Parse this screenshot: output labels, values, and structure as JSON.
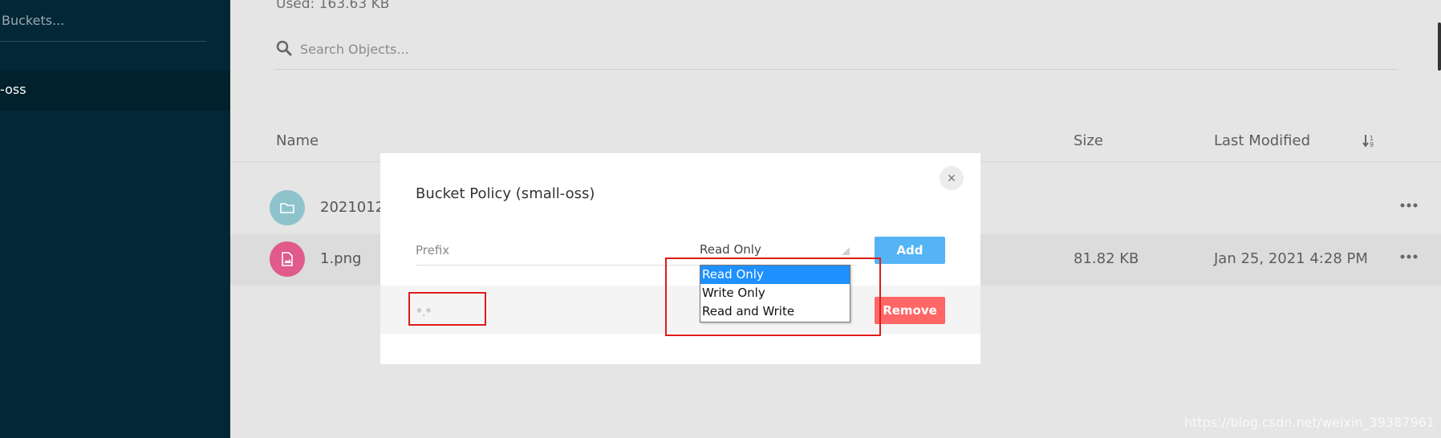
{
  "sidebar": {
    "search_text": "Buckets...",
    "active_bucket": "-oss"
  },
  "main": {
    "used_text": "Used: 163.63 KB",
    "search_placeholder": "Search Objects...",
    "columns": {
      "name": "Name",
      "size": "Size",
      "last_modified": "Last Modified"
    },
    "rows": [
      {
        "name": "2021012",
        "size": "",
        "last_modified": "",
        "type": "folder-icon",
        "icon_color": "#8fc3cc"
      },
      {
        "name": "1.png",
        "size": "81.82 KB",
        "last_modified": "Jan 25, 2021 4:28 PM",
        "type": "image-file-icon",
        "icon_color": "#e05a8a"
      }
    ]
  },
  "modal": {
    "title": "Bucket Policy (small-oss)",
    "close_symbol": "×",
    "prefix_placeholder": "Prefix",
    "select_value": "Read Only",
    "add_label": "Add",
    "remove_label": "Remove",
    "policy_prefix": "*.*",
    "dropdown_options": [
      "Read Only",
      "Write Only",
      "Read and Write"
    ],
    "dropdown_selected_index": 0
  },
  "colors": {
    "sidebar_bg": "#022736",
    "add_button": "#54b4f5",
    "remove_button": "#ff6666",
    "selection_blue": "#1e90ff",
    "annotation_red": "#e01b1b"
  },
  "watermark": "https://blog.csdn.net/weixin_39387961"
}
